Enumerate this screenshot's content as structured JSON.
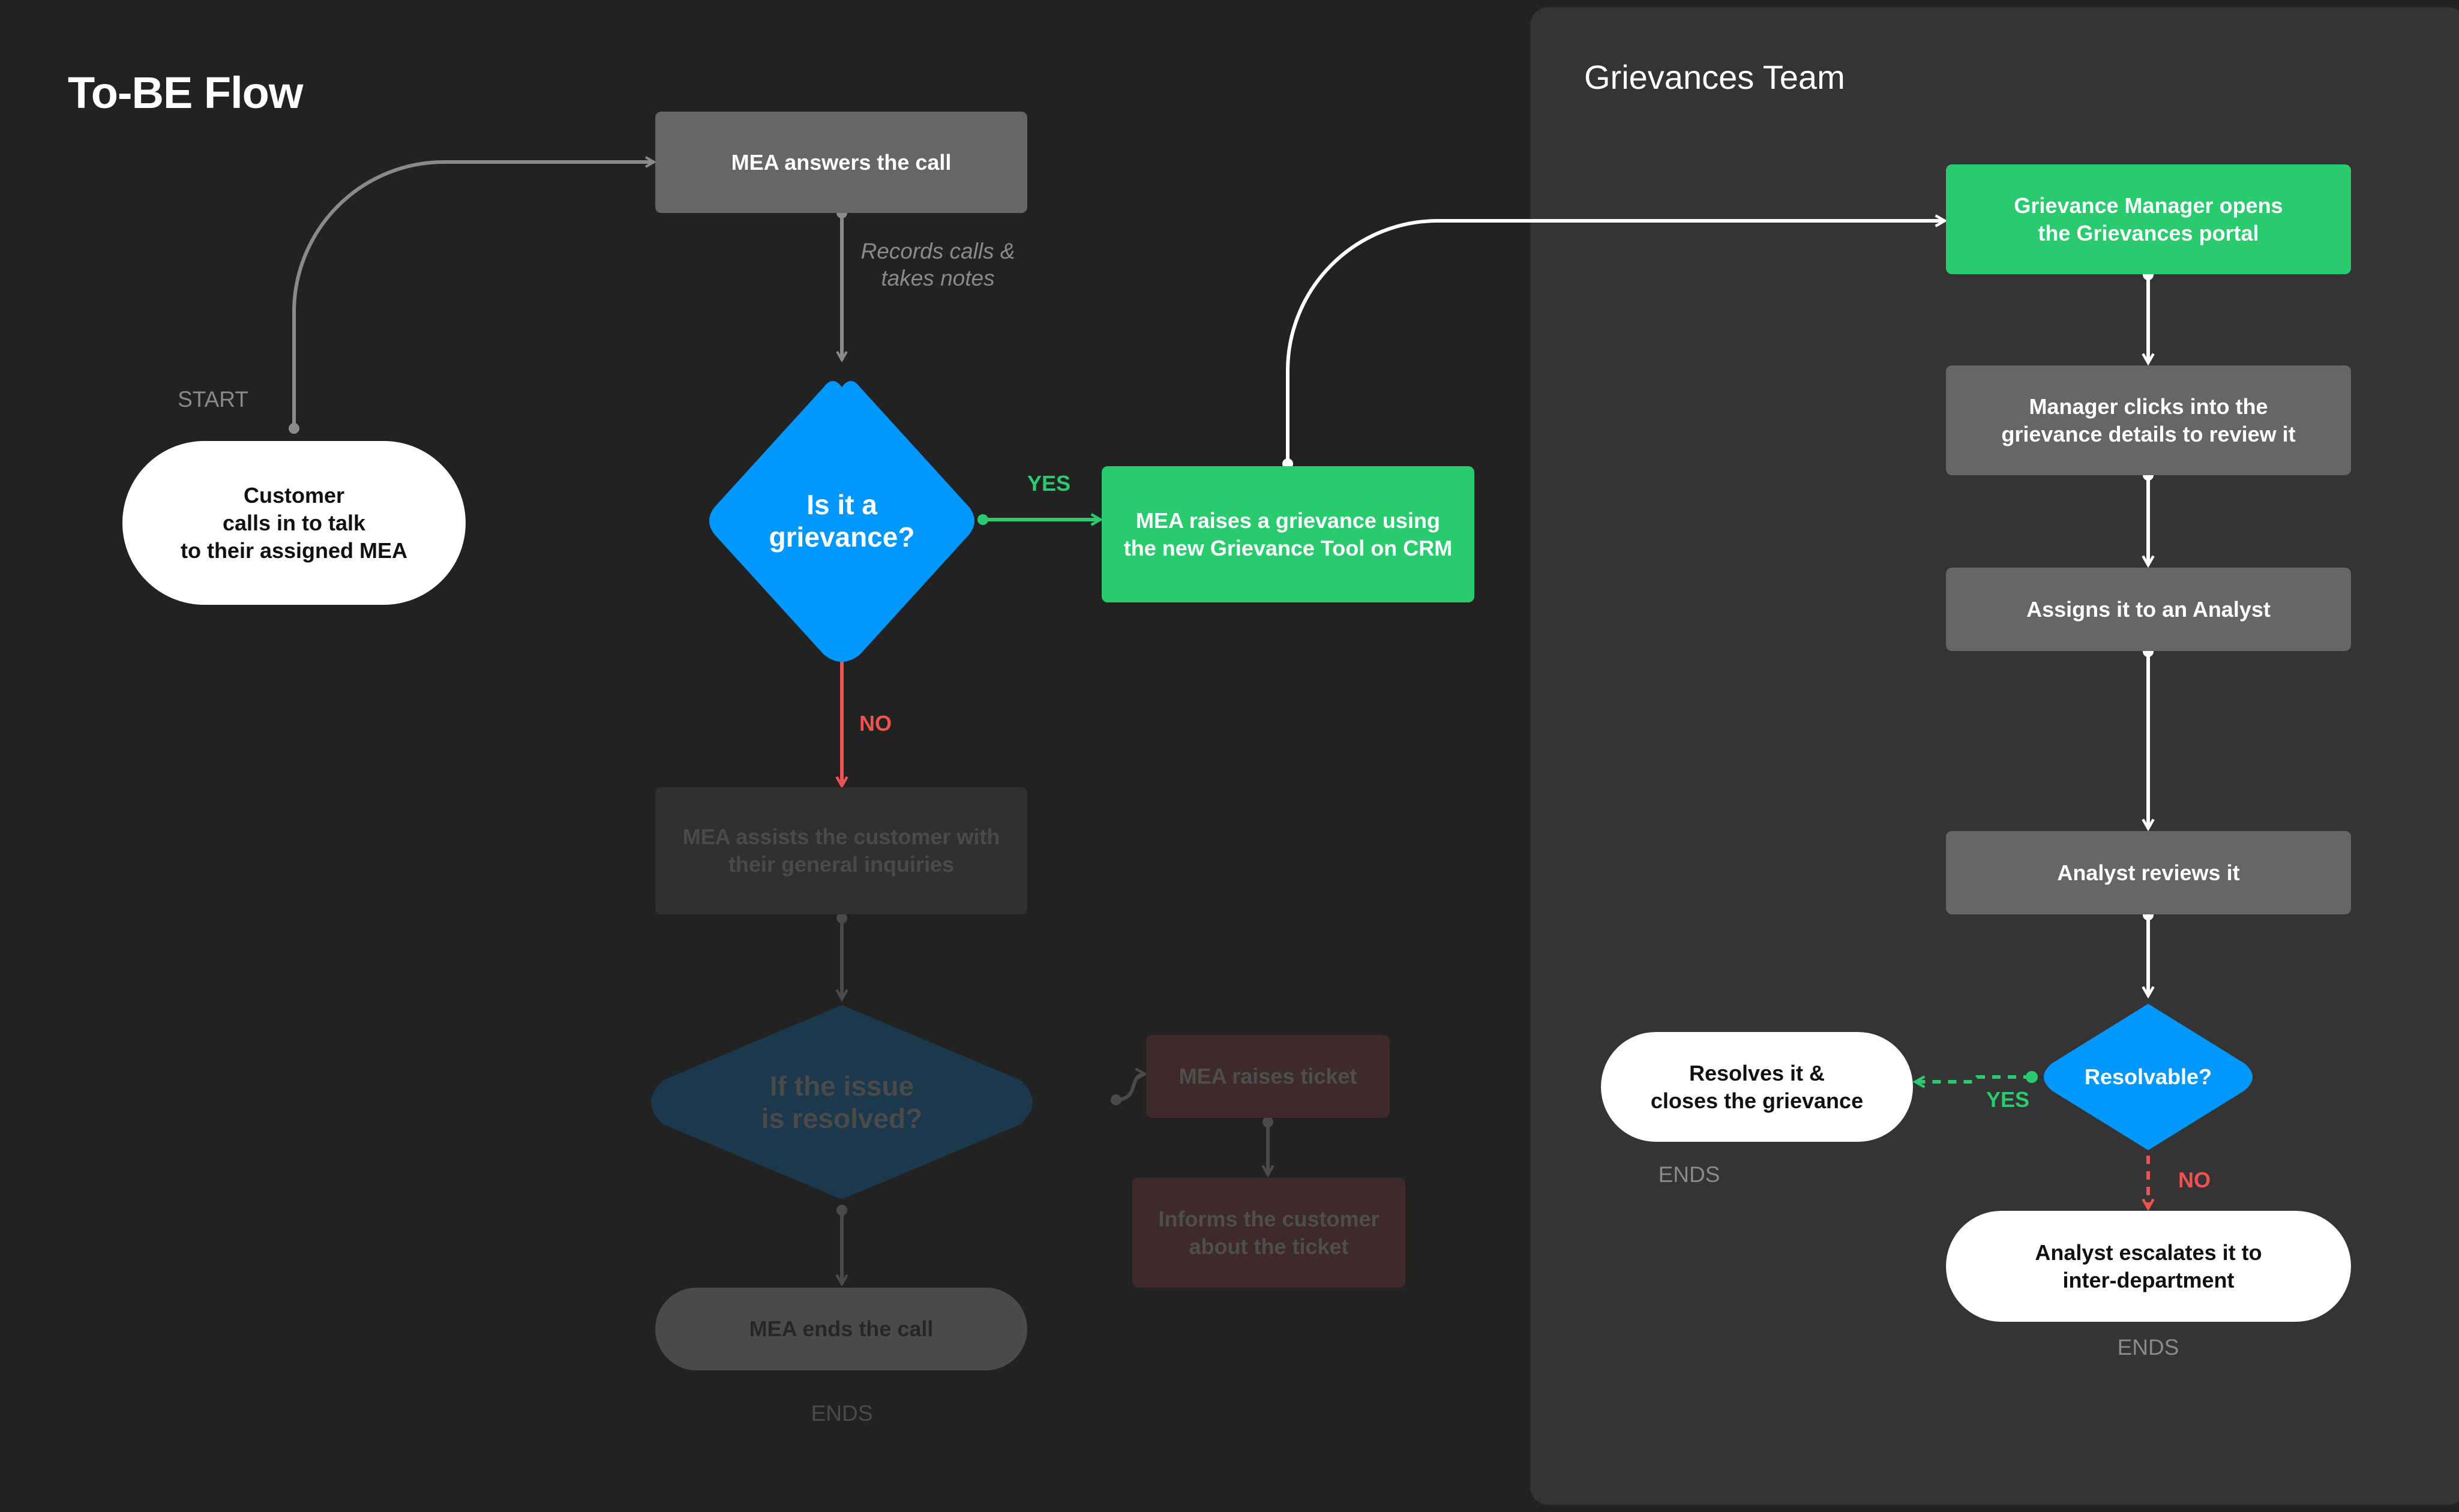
{
  "page": {
    "title": "To-BE Flow"
  },
  "lanes": {
    "grievances_team": {
      "title": "Grievances Team"
    }
  },
  "labels": {
    "start": "START",
    "ends_mea": "ENDS",
    "ends_resolves": "ENDS",
    "ends_escalates": "ENDS",
    "records_note_line1": "Records calls &",
    "records_note_line2": "takes notes",
    "yes_grievance": "YES",
    "no_grievance": "NO",
    "yes_resolvable": "YES",
    "no_resolvable": "NO"
  },
  "nodes": {
    "customer_calls": {
      "lines": [
        "Customer",
        "calls in to talk",
        "to their assigned MEA"
      ]
    },
    "mea_answers": {
      "text": "MEA answers the call"
    },
    "is_grievance": {
      "lines": [
        "Is it a",
        "grievance?"
      ]
    },
    "mea_raises_grievance": {
      "lines": [
        "MEA raises a grievance using",
        "the new Grievance Tool on CRM"
      ]
    },
    "mea_assists": {
      "lines": [
        "MEA assists the customer with",
        "their general inquiries"
      ]
    },
    "issue_resolved": {
      "lines": [
        "If the issue",
        "is resolved?"
      ]
    },
    "mea_raises_ticket": {
      "text": "MEA raises ticket"
    },
    "informs_customer": {
      "lines": [
        "Informs the customer",
        "about the ticket"
      ]
    },
    "mea_ends_call": {
      "text": "MEA ends the call"
    },
    "manager_opens": {
      "lines": [
        "Grievance Manager opens",
        "the Grievances portal"
      ]
    },
    "manager_clicks": {
      "lines": [
        "Manager clicks into the",
        "grievance details to review it"
      ]
    },
    "assigns_analyst": {
      "text": "Assigns it to an Analyst"
    },
    "analyst_reviews": {
      "text": "Analyst reviews it"
    },
    "resolvable": {
      "text": "Resolvable?"
    },
    "resolves_closes": {
      "lines": [
        "Resolves it &",
        "closes the grievance"
      ]
    },
    "escalates": {
      "lines": [
        "Analyst escalates it to",
        "inter-department"
      ]
    }
  },
  "colors": {
    "background": "#222222",
    "lane": "#343434",
    "process": "#666666",
    "highlight": "#2acb6e",
    "decision": "#0098ff",
    "yes": "#2acb6e",
    "no": "#f05252"
  }
}
